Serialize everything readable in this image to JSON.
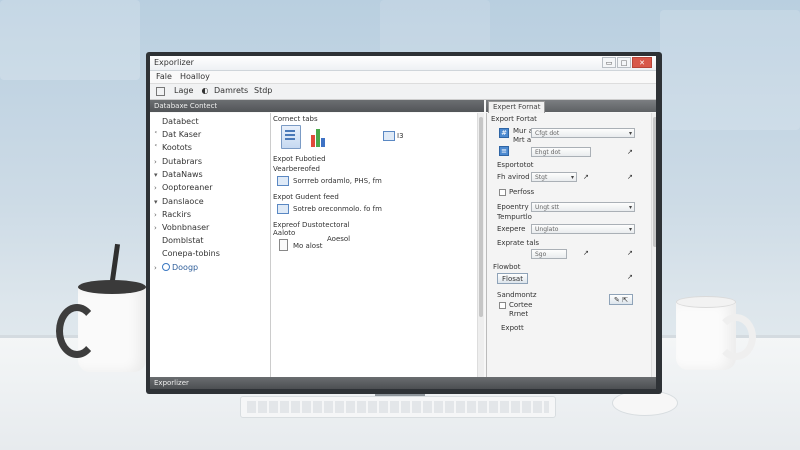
{
  "window": {
    "title": "Exporlizer",
    "btn_min": "▭",
    "btn_max": "□",
    "btn_close": "✕"
  },
  "menu": {
    "items": [
      "Fale",
      "Hoalloy"
    ]
  },
  "toolbar": {
    "items": [
      "Lage",
      "Damrets",
      "Stdp"
    ]
  },
  "panels": {
    "left_header": "Databaxe Contect",
    "right_tab": "Expert Fornat"
  },
  "tree": {
    "items": [
      {
        "label": "Databect",
        "chevron": ""
      },
      {
        "label": "Dat Kaser",
        "chevron": "˂"
      },
      {
        "label": "Kootots",
        "chevron": "˂"
      },
      {
        "label": "Dutabrars",
        "chevron": "›"
      },
      {
        "label": "DataNaws",
        "chevron": "▾"
      },
      {
        "label": "Ooptoreaner",
        "chevron": "›"
      },
      {
        "label": "Danslaoce",
        "chevron": "▾"
      },
      {
        "label": "Rackirs",
        "chevron": "›"
      },
      {
        "label": "Vobnbnaser",
        "chevron": "›"
      },
      {
        "label": "Domblstat",
        "chevron": ""
      },
      {
        "label": "Conepa-tobins",
        "chevron": ""
      },
      {
        "label": "Doogp",
        "chevron": "›"
      }
    ]
  },
  "center": {
    "connect_title": "Cornect tabs",
    "icon_label": "I3",
    "export_title": "Expot Fubotied",
    "sub1_title": "Vearbereofed",
    "sub1_text": "Sorrreb ordamlo, PHS, fm",
    "sub2_title": "Expot Gudent feed",
    "sub2_text": "Sotreb oreconmolo. fo fm",
    "sub3_title": "Expreof Dustotectoral",
    "sub3_sub": "Aaloto",
    "sub3_right": "Aoesol",
    "sub3_file": "Mo alost"
  },
  "right": {
    "section_title": "Export Fortat",
    "row1_a": "Mur a",
    "row1_b": "Mrt a",
    "row1_dd": "Cfgt dot",
    "row2_dd": "Ehgt dot",
    "opts_title": "Esportotot",
    "fh_label": "Fh avirod",
    "fh_dd": "Stgt",
    "perfoss": "Perfoss",
    "epoentry": "Epoentry",
    "ep_dd": "Ungt stt",
    "tempurtlo": "Tempurtlo",
    "ep2_label": "Exepere",
    "ep2_dd": "Unglato",
    "exprate_label": "Exprate tals",
    "exprate_dd": "Sgo",
    "flowbot": "Flowbot",
    "btn_label": "Flosat",
    "sandmontz": "Sandmontz",
    "cortee": "Cortee",
    "rrnet": "Rrnet",
    "expott": "Expott"
  },
  "status": {
    "text": "Exporlizer"
  }
}
